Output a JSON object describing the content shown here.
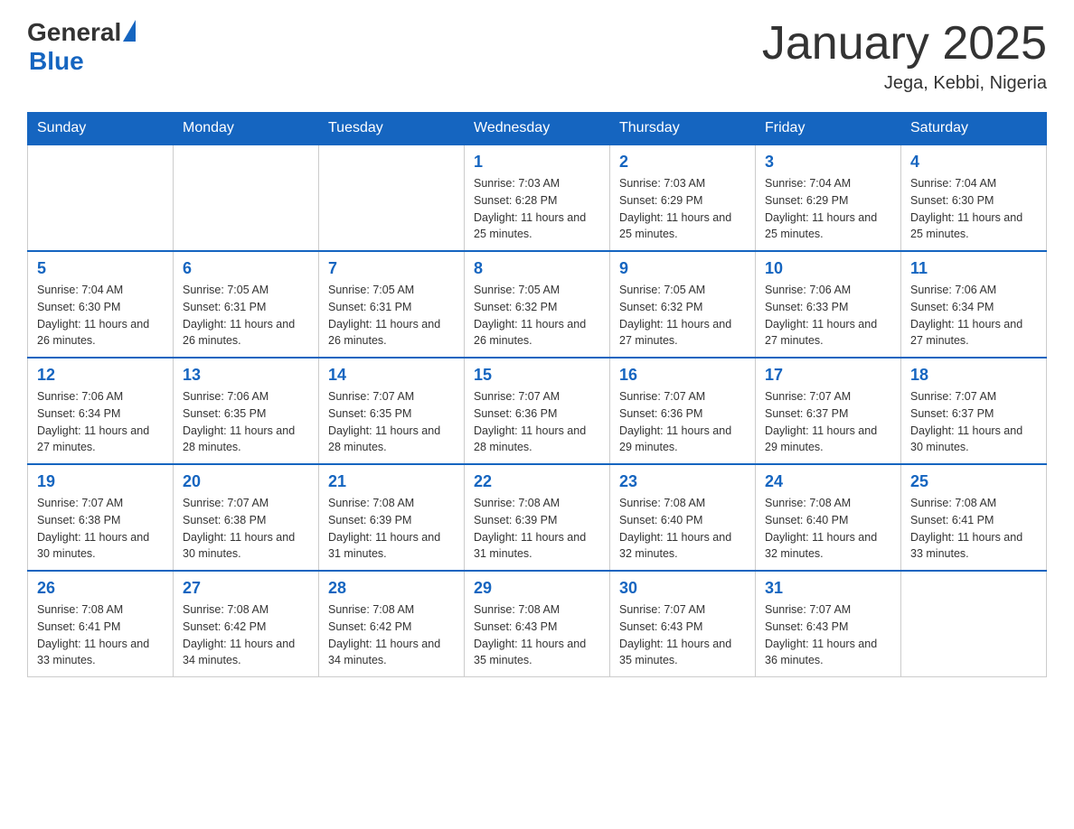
{
  "header": {
    "logo_general": "General",
    "logo_blue": "Blue",
    "title": "January 2025",
    "subtitle": "Jega, Kebbi, Nigeria"
  },
  "weekdays": [
    "Sunday",
    "Monday",
    "Tuesday",
    "Wednesday",
    "Thursday",
    "Friday",
    "Saturday"
  ],
  "weeks": [
    [
      {
        "day": "",
        "info": ""
      },
      {
        "day": "",
        "info": ""
      },
      {
        "day": "",
        "info": ""
      },
      {
        "day": "1",
        "info": "Sunrise: 7:03 AM\nSunset: 6:28 PM\nDaylight: 11 hours and 25 minutes."
      },
      {
        "day": "2",
        "info": "Sunrise: 7:03 AM\nSunset: 6:29 PM\nDaylight: 11 hours and 25 minutes."
      },
      {
        "day": "3",
        "info": "Sunrise: 7:04 AM\nSunset: 6:29 PM\nDaylight: 11 hours and 25 minutes."
      },
      {
        "day": "4",
        "info": "Sunrise: 7:04 AM\nSunset: 6:30 PM\nDaylight: 11 hours and 25 minutes."
      }
    ],
    [
      {
        "day": "5",
        "info": "Sunrise: 7:04 AM\nSunset: 6:30 PM\nDaylight: 11 hours and 26 minutes."
      },
      {
        "day": "6",
        "info": "Sunrise: 7:05 AM\nSunset: 6:31 PM\nDaylight: 11 hours and 26 minutes."
      },
      {
        "day": "7",
        "info": "Sunrise: 7:05 AM\nSunset: 6:31 PM\nDaylight: 11 hours and 26 minutes."
      },
      {
        "day": "8",
        "info": "Sunrise: 7:05 AM\nSunset: 6:32 PM\nDaylight: 11 hours and 26 minutes."
      },
      {
        "day": "9",
        "info": "Sunrise: 7:05 AM\nSunset: 6:32 PM\nDaylight: 11 hours and 27 minutes."
      },
      {
        "day": "10",
        "info": "Sunrise: 7:06 AM\nSunset: 6:33 PM\nDaylight: 11 hours and 27 minutes."
      },
      {
        "day": "11",
        "info": "Sunrise: 7:06 AM\nSunset: 6:34 PM\nDaylight: 11 hours and 27 minutes."
      }
    ],
    [
      {
        "day": "12",
        "info": "Sunrise: 7:06 AM\nSunset: 6:34 PM\nDaylight: 11 hours and 27 minutes."
      },
      {
        "day": "13",
        "info": "Sunrise: 7:06 AM\nSunset: 6:35 PM\nDaylight: 11 hours and 28 minutes."
      },
      {
        "day": "14",
        "info": "Sunrise: 7:07 AM\nSunset: 6:35 PM\nDaylight: 11 hours and 28 minutes."
      },
      {
        "day": "15",
        "info": "Sunrise: 7:07 AM\nSunset: 6:36 PM\nDaylight: 11 hours and 28 minutes."
      },
      {
        "day": "16",
        "info": "Sunrise: 7:07 AM\nSunset: 6:36 PM\nDaylight: 11 hours and 29 minutes."
      },
      {
        "day": "17",
        "info": "Sunrise: 7:07 AM\nSunset: 6:37 PM\nDaylight: 11 hours and 29 minutes."
      },
      {
        "day": "18",
        "info": "Sunrise: 7:07 AM\nSunset: 6:37 PM\nDaylight: 11 hours and 30 minutes."
      }
    ],
    [
      {
        "day": "19",
        "info": "Sunrise: 7:07 AM\nSunset: 6:38 PM\nDaylight: 11 hours and 30 minutes."
      },
      {
        "day": "20",
        "info": "Sunrise: 7:07 AM\nSunset: 6:38 PM\nDaylight: 11 hours and 30 minutes."
      },
      {
        "day": "21",
        "info": "Sunrise: 7:08 AM\nSunset: 6:39 PM\nDaylight: 11 hours and 31 minutes."
      },
      {
        "day": "22",
        "info": "Sunrise: 7:08 AM\nSunset: 6:39 PM\nDaylight: 11 hours and 31 minutes."
      },
      {
        "day": "23",
        "info": "Sunrise: 7:08 AM\nSunset: 6:40 PM\nDaylight: 11 hours and 32 minutes."
      },
      {
        "day": "24",
        "info": "Sunrise: 7:08 AM\nSunset: 6:40 PM\nDaylight: 11 hours and 32 minutes."
      },
      {
        "day": "25",
        "info": "Sunrise: 7:08 AM\nSunset: 6:41 PM\nDaylight: 11 hours and 33 minutes."
      }
    ],
    [
      {
        "day": "26",
        "info": "Sunrise: 7:08 AM\nSunset: 6:41 PM\nDaylight: 11 hours and 33 minutes."
      },
      {
        "day": "27",
        "info": "Sunrise: 7:08 AM\nSunset: 6:42 PM\nDaylight: 11 hours and 34 minutes."
      },
      {
        "day": "28",
        "info": "Sunrise: 7:08 AM\nSunset: 6:42 PM\nDaylight: 11 hours and 34 minutes."
      },
      {
        "day": "29",
        "info": "Sunrise: 7:08 AM\nSunset: 6:43 PM\nDaylight: 11 hours and 35 minutes."
      },
      {
        "day": "30",
        "info": "Sunrise: 7:07 AM\nSunset: 6:43 PM\nDaylight: 11 hours and 35 minutes."
      },
      {
        "day": "31",
        "info": "Sunrise: 7:07 AM\nSunset: 6:43 PM\nDaylight: 11 hours and 36 minutes."
      },
      {
        "day": "",
        "info": ""
      }
    ]
  ]
}
